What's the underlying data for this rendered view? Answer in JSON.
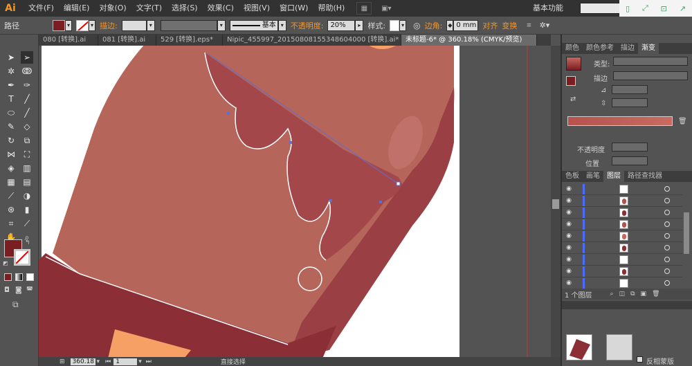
{
  "app": {
    "logo": "Ai"
  },
  "menu": [
    "文件(F)",
    "编辑(E)",
    "对象(O)",
    "文字(T)",
    "选择(S)",
    "效果(C)",
    "视图(V)",
    "窗口(W)",
    "帮助(H)"
  ],
  "workspace": "基本功能",
  "control": {
    "path_label": "路径",
    "stroke_label": "描边:",
    "stroke_style": "基本",
    "opacity_label": "不透明度:",
    "opacity_value": "20%",
    "style_label": "样式:",
    "corner_label": "边角:",
    "corner_value": "0 mm",
    "align_label": "对齐",
    "transform_label": "变换"
  },
  "tabs": [
    "080 [转换].ai",
    "081 [转换].ai",
    "529 [转换].eps*",
    "Nipic_455997_20150808155348604000 [转换].ai*",
    "未标题-6* @ 360.18% (CMYK/预览)"
  ],
  "gradient_panel": {
    "tabs": [
      "颜色",
      "颜色参考",
      "描边",
      "渐变"
    ],
    "type_label": "类型:",
    "stroke_label": "描边",
    "opacity_label": "不透明度",
    "position_label": "位置"
  },
  "layers_panel": {
    "tabs": [
      "色板",
      "画笔",
      "图层",
      "路径查找器"
    ],
    "footer": "1 个图层",
    "row_count": 9
  },
  "bottom_panel": {
    "checkbox_label": "反相蒙版"
  },
  "status": {
    "zoom": "360.18",
    "page": "1",
    "tool": "直接选择"
  },
  "colors": {
    "body": "#b5655a",
    "body_dark": "#8b2e36",
    "drip": "#a3474b",
    "accent": "#f79522",
    "fill_swatch": "#7b1e22"
  }
}
